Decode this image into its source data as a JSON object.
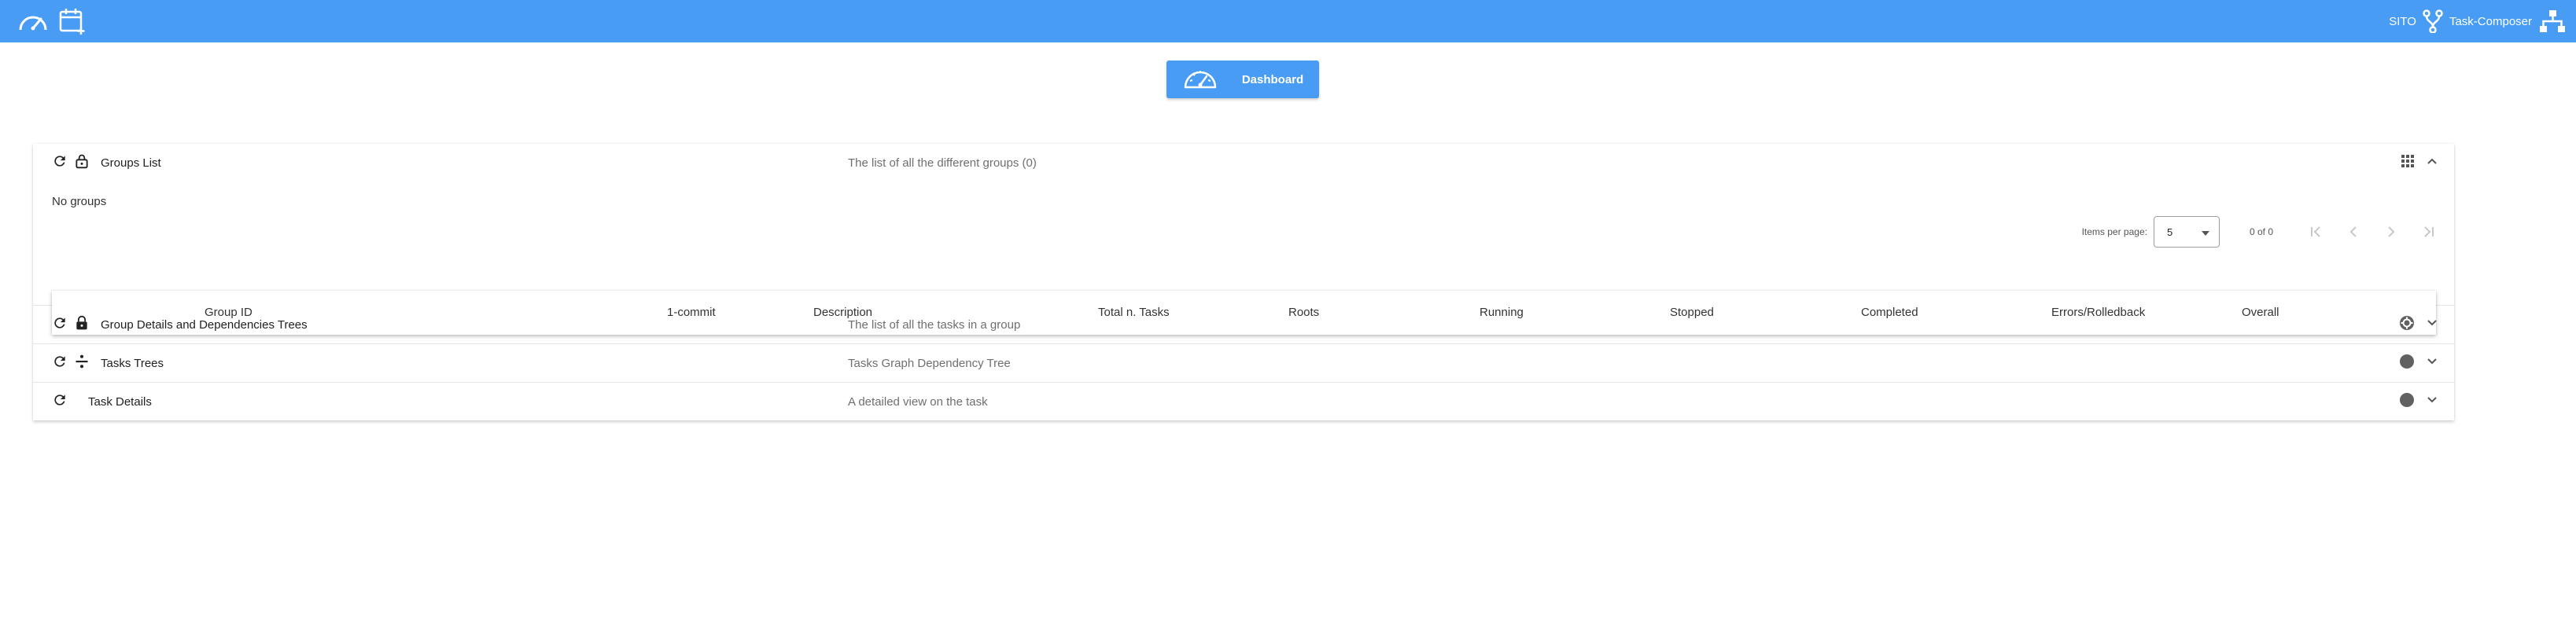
{
  "toolbar": {
    "left_icons": [
      "speedometer-icon",
      "calendar-add-icon"
    ],
    "right_label_1": "SITO",
    "right_icon_1": "fork-icon",
    "right_label_2": "Task-Composer",
    "right_icon_2": "sitemap-icon"
  },
  "dashboard_button": {
    "label": "Dashboard",
    "icon": "speedometer-icon"
  },
  "groups_list": {
    "title": "Groups List",
    "description": "The list of all the different groups (0)",
    "empty_text": "No groups",
    "paginator": {
      "items_per_page_label": "Items per page:",
      "items_per_page_value": "5",
      "range_label": "0 of 0"
    },
    "columns": [
      "Group ID",
      "1-commit",
      "Description",
      "Total n. Tasks",
      "Roots",
      "Running",
      "Stopped",
      "Completed",
      "Errors/Rolledback",
      "Overall"
    ]
  },
  "sections": [
    {
      "title": "Group Details and Dependencies Trees",
      "description": "The list of all the tasks in a group"
    },
    {
      "title": "Tasks Trees",
      "description": "Tasks Graph Dependency Tree"
    },
    {
      "title": "Task Details",
      "description": "A detailed view on the task"
    }
  ],
  "colors": {
    "primary": "#489cf4",
    "status_dot": "#616161"
  }
}
